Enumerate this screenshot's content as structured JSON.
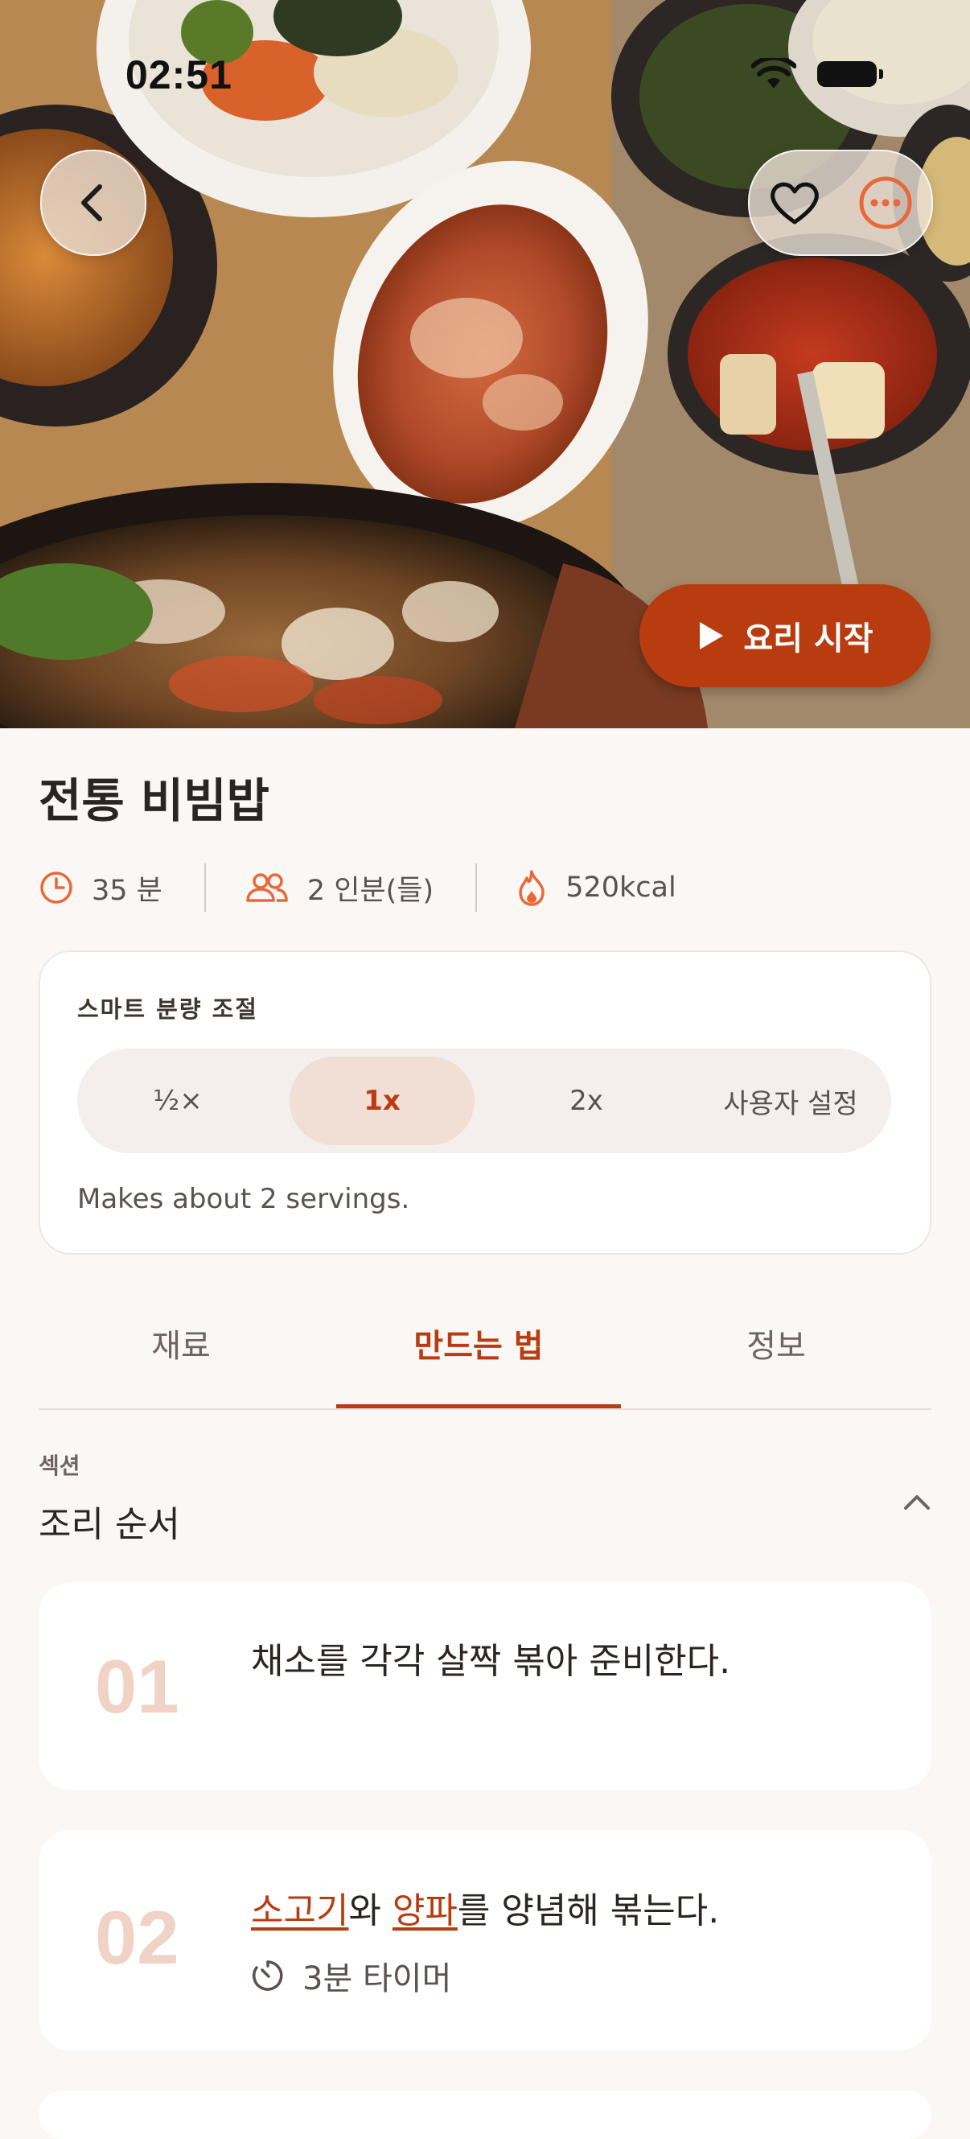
{
  "status": {
    "time": "02:51"
  },
  "hero": {
    "back_icon": "chevron-left-icon",
    "favorite_icon": "heart-icon",
    "more_icon": "more-horizontal-icon",
    "start_label": "요리 시작"
  },
  "recipe": {
    "title": "전통 비빔밥",
    "time": "35 분",
    "servings": "2 인분(들)",
    "calories": "520kcal"
  },
  "scaling": {
    "label": "스마트 분량 조절",
    "options": [
      "½×",
      "1x",
      "2x",
      "사용자 설정"
    ],
    "selected": "1x",
    "note": "Makes about 2 servings."
  },
  "tabs": [
    "재료",
    "만드는 법",
    "정보"
  ],
  "active_tab": "만드는 법",
  "section": {
    "label": "섹션",
    "title": "조리 순서"
  },
  "steps": [
    {
      "num": "01",
      "text": "채소를 각각 살짝 볶아 준비한다."
    },
    {
      "num": "02",
      "parts": [
        "소고기",
        "와 ",
        "양파",
        "를 양념해 볶는다."
      ],
      "timer": "3분 타이머"
    }
  ],
  "colors": {
    "accent": "#b83c10",
    "step_number": "#f0d3c6",
    "background": "#fbf7f4"
  }
}
